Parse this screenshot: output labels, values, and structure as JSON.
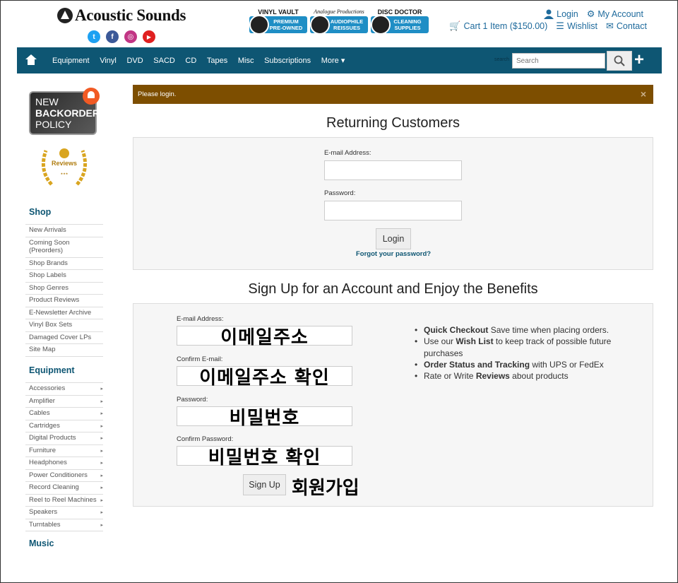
{
  "header": {
    "logo_text": "Acoustic Sounds",
    "social": [
      {
        "name": "twitter-icon",
        "glyph": "t",
        "color": "#1da1f2"
      },
      {
        "name": "facebook-icon",
        "glyph": "f",
        "color": "#3b5998"
      },
      {
        "name": "instagram-icon",
        "glyph": "◎",
        "color": "#c13584"
      },
      {
        "name": "youtube-icon",
        "glyph": "▶",
        "color": "#e02020"
      }
    ],
    "banners": [
      {
        "title": "VINYL VAULT",
        "text": "PREMIUM PRE-OWNED"
      },
      {
        "title": "Analogue Productions",
        "text": "AUDIOPHILE REISSUES"
      },
      {
        "title": "DISC DOCTOR",
        "text": "CLEANING SUPPLIES"
      }
    ],
    "account": {
      "login": "Login",
      "my_account": "My Account",
      "cart": "Cart 1 Item ($150.00)",
      "wishlist": "Wishlist",
      "contact": "Contact"
    }
  },
  "nav": {
    "items": [
      "Equipment",
      "Vinyl",
      "DVD",
      "SACD",
      "CD",
      "Tapes",
      "Misc",
      "Subscriptions",
      "More ▾"
    ],
    "search_label": "search",
    "search_placeholder": "Search"
  },
  "sidebar": {
    "backorder": {
      "line1": "NEW",
      "line2": "BACKORDER",
      "line3": "POLICY"
    },
    "reviews_badge": "Reviews",
    "shop_heading": "Shop",
    "shop_items": [
      "New Arrivals",
      "Coming Soon (Preorders)",
      "Shop Brands",
      "Shop Labels",
      "Shop Genres",
      "Product Reviews",
      "E-Newsletter Archive",
      "Vinyl Box Sets",
      "Damaged Cover LPs",
      "Site Map"
    ],
    "equipment_heading": "Equipment",
    "equipment_items": [
      "Accessories",
      "Amplifier",
      "Cables",
      "Cartridges",
      "Digital Products",
      "Furniture",
      "Headphones",
      "Power Conditioners",
      "Record Cleaning",
      "Reel to Reel Machines",
      "Speakers",
      "Turntables"
    ],
    "music_heading": "Music"
  },
  "alert": {
    "text": "Please login.",
    "close": "×"
  },
  "login": {
    "heading": "Returning Customers",
    "email_label": "E-mail Address:",
    "password_label": "Password:",
    "button": "Login",
    "forgot": "Forgot your password?"
  },
  "signup": {
    "heading": "Sign Up for an Account and Enjoy the Benefits",
    "email_label": "E-mail Address:",
    "email_overlay": "이메일주소",
    "confirm_email_label": "Confirm E-mail:",
    "confirm_email_overlay": "이메일주소 확인",
    "password_label": "Password:",
    "password_overlay": "비밀번호",
    "confirm_password_label": "Confirm Password:",
    "confirm_password_overlay": "비밀번호 확인",
    "button": "Sign Up",
    "button_overlay": "회원가입",
    "benefits": [
      {
        "strong": "Quick Checkout",
        "rest": " Save time when placing orders."
      },
      {
        "pre": "Use our ",
        "strong": "Wish List",
        "rest": " to keep track of possible future purchases"
      },
      {
        "strong": "Order Status and Tracking",
        "rest": " with UPS or FedEx"
      },
      {
        "pre": "Rate or Write ",
        "strong": "Reviews",
        "rest": " about products"
      }
    ]
  }
}
